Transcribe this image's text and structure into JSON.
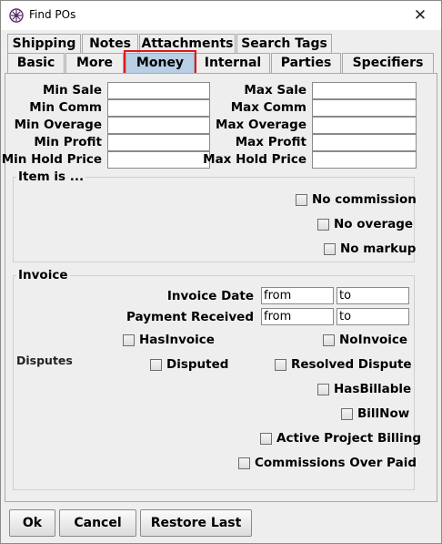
{
  "window": {
    "title": "Find POs",
    "close_glyph": "✕",
    "app_icon": "flower-icon"
  },
  "tabs": {
    "row1": [
      "Shipping",
      "Notes",
      "Attachments",
      "Search Tags"
    ],
    "row2": [
      "Basic",
      "More",
      "Money",
      "Internal",
      "Parties",
      "Specifiers"
    ],
    "selected": "Money"
  },
  "money": {
    "min_sale": "Min Sale",
    "max_sale": "Max Sale",
    "min_comm": "Min Comm",
    "max_comm": "Max Comm",
    "min_overage": "Min Overage",
    "max_overage": "Max Overage",
    "min_profit": "Min Profit",
    "max_profit": "Max Profit",
    "min_hold_price": "Min Hold Price",
    "max_hold_price": "Max Hold Price"
  },
  "item_is": {
    "title": "Item is ...",
    "no_commission": "No commission",
    "no_overage": "No overage",
    "no_markup": "No markup"
  },
  "invoice": {
    "title": "Invoice",
    "invoice_date_label": "Invoice Date",
    "payment_received_label": "Payment Received",
    "from_value": "from",
    "to_value": "to",
    "has_invoice": "HasInvoice",
    "no_invoice": "NoInvoice",
    "disputes_label": "Disputes",
    "disputed": "Disputed",
    "resolved_dispute": "Resolved Dispute",
    "has_billable": "HasBillable",
    "bill_now": "BillNow",
    "active_project_billing": "Active Project Billing",
    "commissions_over_paid": "Commissions Over Paid"
  },
  "buttons": {
    "ok": "Ok",
    "cancel": "Cancel",
    "restore_last": "Restore Last"
  },
  "colors": {
    "selected_tab": "#b8cfe5",
    "highlight": "#e0181e"
  }
}
